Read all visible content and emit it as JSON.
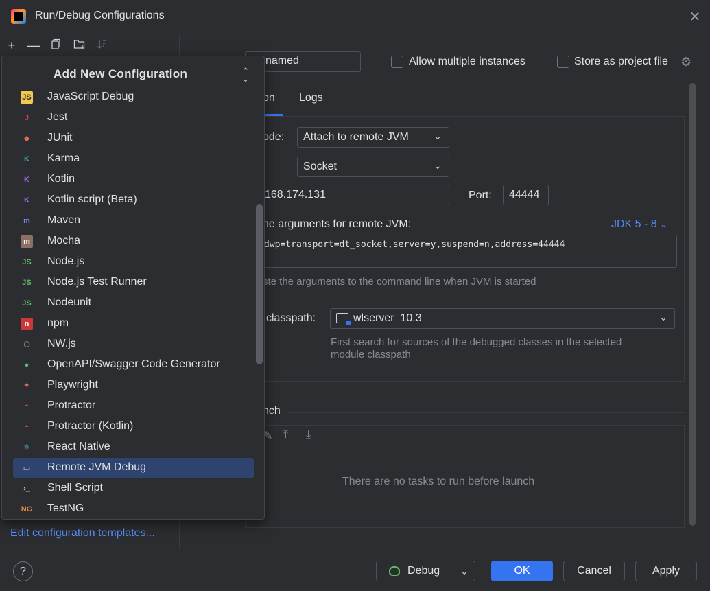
{
  "window": {
    "title": "Run/Debug Configurations",
    "close_glyph": "✕"
  },
  "toolbar": {
    "add": "+",
    "remove": "—"
  },
  "config": {
    "name_value": "named",
    "allow_multiple": "Allow multiple instances",
    "store_as_project": "Store as project file",
    "tabs": {
      "configuration": "on",
      "logs": "Logs"
    },
    "debugger_mode_label": "ode:",
    "debugger_mode_value": "Attach to remote JVM",
    "transport_value": "Socket",
    "host_value": "168.174.131",
    "port_label": "Port:",
    "port_value": "44444",
    "args_label": "ne arguments for remote JVM:",
    "jdk_link": "JDK 5 - 8",
    "args_value": "dwp=transport=dt_socket,server=y,suspend=n,address=44444",
    "args_hint": "ste the arguments to the command line when JVM is started",
    "classpath_label": "classpath:",
    "classpath_value": "wlserver_10.3",
    "classpath_hint_1": "First search for sources of the debugged classes in the selected",
    "classpath_hint_2": "module classpath"
  },
  "before_launch": {
    "title": "nch",
    "empty_text": "There are no tasks to run before launch"
  },
  "popup": {
    "title": "Add New Configuration",
    "items": [
      {
        "label": "JavaScript Debug",
        "icon": "js-icon",
        "glyph": "JS",
        "color": "#f2c94c",
        "fg": "#2b2d30"
      },
      {
        "label": "Jest",
        "icon": "jest-icon",
        "glyph": "J",
        "color": "transparent",
        "fg": "#c63d5e"
      },
      {
        "label": "JUnit",
        "icon": "junit-icon",
        "glyph": "◆",
        "color": "transparent",
        "fg": "#e06c5c"
      },
      {
        "label": "Karma",
        "icon": "karma-icon",
        "glyph": "K",
        "color": "transparent",
        "fg": "#3fb6a8"
      },
      {
        "label": "Kotlin",
        "icon": "kotlin-icon",
        "glyph": "K",
        "color": "transparent",
        "fg": "#a774e8"
      },
      {
        "label": "Kotlin script (Beta)",
        "icon": "kotlin-script-icon",
        "glyph": "K",
        "color": "transparent",
        "fg": "#a774e8"
      },
      {
        "label": "Maven",
        "icon": "maven-icon",
        "glyph": "m",
        "color": "transparent",
        "fg": "#6f8cf5"
      },
      {
        "label": "Mocha",
        "icon": "mocha-icon",
        "glyph": "m",
        "color": "#8d6e63",
        "fg": "#ffffff"
      },
      {
        "label": "Node.js",
        "icon": "nodejs-icon",
        "glyph": "JS",
        "color": "transparent",
        "fg": "#5fb865"
      },
      {
        "label": "Node.js Test Runner",
        "icon": "nodejs-test-icon",
        "glyph": "JS",
        "color": "transparent",
        "fg": "#5fb865"
      },
      {
        "label": "Nodeunit",
        "icon": "nodeunit-icon",
        "glyph": "JS",
        "color": "transparent",
        "fg": "#5fb865"
      },
      {
        "label": "npm",
        "icon": "npm-icon",
        "glyph": "n",
        "color": "#cb3837",
        "fg": "#ffffff"
      },
      {
        "label": "NW.js",
        "icon": "nwjs-icon",
        "glyph": "⬡",
        "color": "transparent",
        "fg": "#9da0a8"
      },
      {
        "label": "OpenAPI/Swagger Code Generator",
        "icon": "swagger-icon",
        "glyph": "●",
        "color": "transparent",
        "fg": "#5fb865"
      },
      {
        "label": "Playwright",
        "icon": "playwright-icon",
        "glyph": "✦",
        "color": "transparent",
        "fg": "#e06c5c"
      },
      {
        "label": "Protractor",
        "icon": "protractor-icon",
        "glyph": "◓",
        "color": "transparent",
        "fg": "#e0404a"
      },
      {
        "label": "Protractor (Kotlin)",
        "icon": "protractor-kotlin-icon",
        "glyph": "◓",
        "color": "transparent",
        "fg": "#e0404a"
      },
      {
        "label": "React Native",
        "icon": "react-icon",
        "glyph": "⚛",
        "color": "transparent",
        "fg": "#5ccfe6"
      },
      {
        "label": "Remote JVM Debug",
        "icon": "remote-jvm-icon",
        "glyph": "▭",
        "color": "transparent",
        "fg": "#ced0d6"
      },
      {
        "label": "Shell Script",
        "icon": "shell-icon",
        "glyph": "›_",
        "color": "transparent",
        "fg": "#ced0d6"
      },
      {
        "label": "TestNG",
        "icon": "testng-icon",
        "glyph": "NG",
        "color": "transparent",
        "fg": "#e08a3c"
      }
    ],
    "selected_index": 18
  },
  "edit_templates": "Edit configuration templates...",
  "footer": {
    "help": "?",
    "debug": "Debug",
    "ok": "OK",
    "cancel": "Cancel",
    "apply": "Apply"
  }
}
